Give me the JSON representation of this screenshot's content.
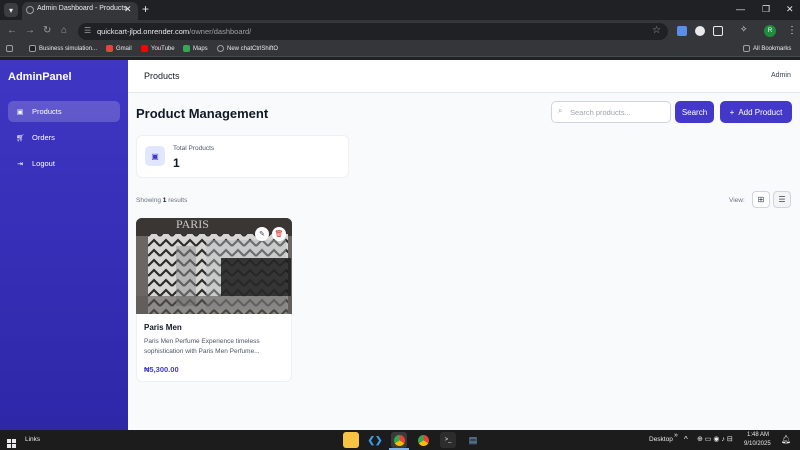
{
  "browser": {
    "tab_title": "Admin Dashboard - Products",
    "url_host": "quickcart-jlpd.onrender.com",
    "url_path": "/owner/dashboard/",
    "bookmarks": [
      "Business simulation...",
      "Gmail",
      "YouTube",
      "Maps",
      "New chatCtrlShiftO"
    ],
    "all_bookmarks": "All Bookmarks",
    "profile_initial": "R"
  },
  "sidebar": {
    "brand": "AdminPanel",
    "items": [
      {
        "label": "Products",
        "icon": "box-icon",
        "active": true
      },
      {
        "label": "Orders",
        "icon": "cart-icon",
        "active": false
      },
      {
        "label": "Logout",
        "icon": "logout-icon",
        "active": false
      }
    ]
  },
  "topbar": {
    "title": "Products",
    "user": "Admin"
  },
  "main": {
    "title": "Product Management",
    "search_placeholder": "Search products...",
    "search_button": "Search",
    "add_button": "Add Product",
    "stats": {
      "label": "Total Products",
      "value": "1"
    },
    "results_prefix": "Showing",
    "results_count": "1",
    "results_suffix": "results",
    "view_label": "View:"
  },
  "products": [
    {
      "name": "Paris Men",
      "description": "Paris Men Perfume Experience timeless sophistication with Paris Men Perfume...",
      "price": "₦5,300.00",
      "image_text": "PARIS"
    }
  ],
  "taskbar": {
    "left_label": "Links",
    "desktop_label": "Desktop",
    "time": "1:48 AM",
    "date": "9/10/2025"
  },
  "colors": {
    "accent": "#4338ca",
    "sidebar": "#3f36c4",
    "delete": "#dc2626"
  }
}
